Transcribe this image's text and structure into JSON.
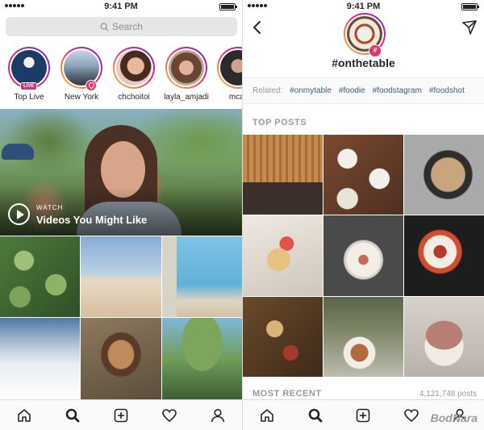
{
  "status_bar": {
    "time": "9:41 PM"
  },
  "explore": {
    "search_placeholder": "Search",
    "stories": [
      {
        "label": "Top Live",
        "badge": "LIVE"
      },
      {
        "label": "New York"
      },
      {
        "label": "chchoitoi"
      },
      {
        "label": "layla_amjadi"
      },
      {
        "label": "mcar"
      }
    ],
    "video": {
      "kicker": "WATCH",
      "title": "Videos You Might Like"
    }
  },
  "hashtag_page": {
    "badge_symbol": "#",
    "title": "#onthetable",
    "related_label": "Related:",
    "related_tags": [
      "#onmytable",
      "#foodie",
      "#foodstagram",
      "#foodshot"
    ],
    "top_posts_label": "TOP POSTS",
    "most_recent_label": "MOST RECENT",
    "post_count": "4,121,748 posts"
  },
  "tab_icons": [
    "home-icon",
    "search-icon",
    "new-post-icon",
    "activity-icon",
    "profile-icon"
  ],
  "watermark": "BodNara",
  "colors": {
    "accent_pink": "#e1306c",
    "link_blue": "#3b5b8a",
    "gradient": [
      "#f9ce34",
      "#ee2a7b",
      "#6228d7"
    ]
  }
}
